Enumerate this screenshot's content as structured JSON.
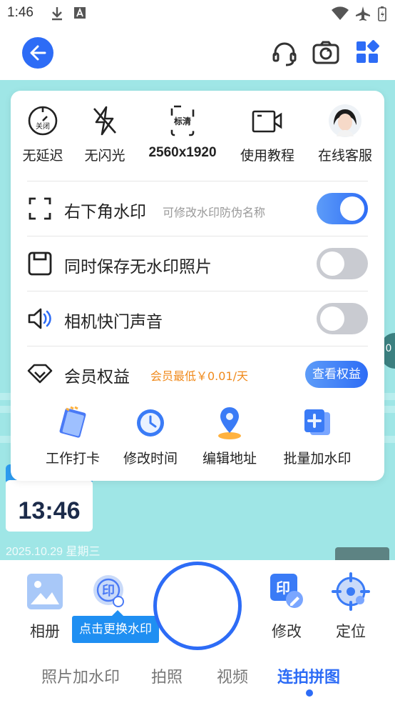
{
  "status": {
    "time": "1:46"
  },
  "quick": [
    {
      "label": "无延迟",
      "icon_text": "关闭",
      "icon": "timer-off-icon"
    },
    {
      "label": "无闪光",
      "icon": "flash-off-icon"
    },
    {
      "label": "2560x1920",
      "icon_text": "标清",
      "icon": "resolution-icon"
    },
    {
      "label": "使用教程",
      "icon": "video-tutorial-icon"
    },
    {
      "label": "在线客服",
      "icon": "service-avatar-icon"
    }
  ],
  "settings": {
    "watermark": {
      "label": "右下角水印",
      "sub": "可修改水印防伪名称",
      "on": true
    },
    "save_plain": {
      "label": "同时保存无水印照片",
      "on": false
    },
    "shutter_sound": {
      "label": "相机快门声音",
      "on": false
    },
    "vip": {
      "label": "会员权益",
      "note": "会员最低￥0.01/天",
      "button": "查看权益"
    }
  },
  "features": [
    {
      "label": "工作打卡",
      "icon": "notebook-icon"
    },
    {
      "label": "修改时间",
      "icon": "clock-icon"
    },
    {
      "label": "编辑地址",
      "icon": "location-pin-icon"
    },
    {
      "label": "批量加水印",
      "icon": "batch-watermark-icon"
    }
  ],
  "watermark_preview": {
    "time": "13:46",
    "date": "2025.10.29 星期三"
  },
  "toolbar": {
    "album": "相册",
    "tip": "点击更换水印",
    "edit": "修改",
    "locate": "定位"
  },
  "tabs": [
    "照片加水印",
    "拍照",
    "视频",
    "连拍拼图"
  ],
  "active_tab": "连拍拼图",
  "colors": {
    "accent": "#2d6cf6",
    "preview_bg": "#9fe6e6",
    "note": "#f08a1c"
  }
}
